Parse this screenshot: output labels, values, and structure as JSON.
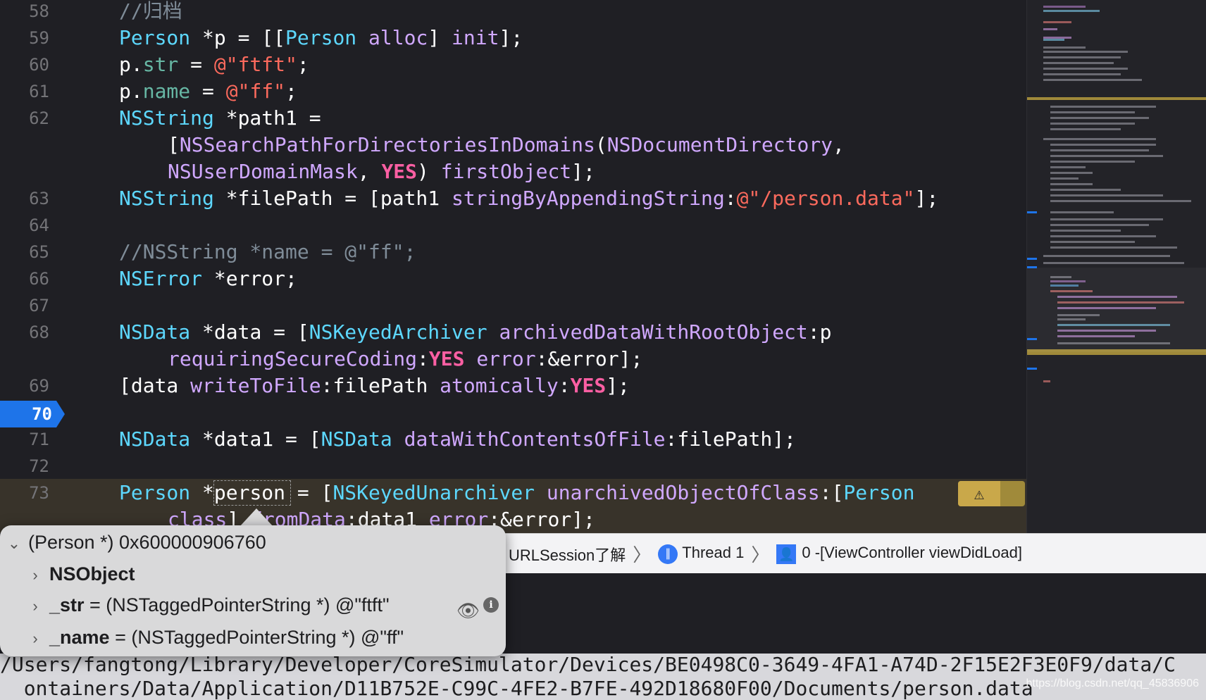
{
  "editor": {
    "lines": [
      {
        "num": "58",
        "tokens": [
          {
            "t": "//归档",
            "c": "cmt"
          }
        ]
      },
      {
        "num": "59",
        "tokens": [
          {
            "t": "Person",
            "c": "cls"
          },
          {
            "t": " *p = [[",
            "c": "plain"
          },
          {
            "t": "Person",
            "c": "cls"
          },
          {
            "t": " ",
            "c": "plain"
          },
          {
            "t": "alloc",
            "c": "meth"
          },
          {
            "t": "] ",
            "c": "plain"
          },
          {
            "t": "init",
            "c": "meth"
          },
          {
            "t": "];",
            "c": "plain"
          }
        ]
      },
      {
        "num": "60",
        "tokens": [
          {
            "t": "p.",
            "c": "plain"
          },
          {
            "t": "str",
            "c": "prop"
          },
          {
            "t": " = ",
            "c": "plain"
          },
          {
            "t": "@\"ftft\"",
            "c": "str"
          },
          {
            "t": ";",
            "c": "plain"
          }
        ]
      },
      {
        "num": "61",
        "tokens": [
          {
            "t": "p.",
            "c": "plain"
          },
          {
            "t": "name",
            "c": "prop"
          },
          {
            "t": " = ",
            "c": "plain"
          },
          {
            "t": "@\"ff\"",
            "c": "str"
          },
          {
            "t": ";",
            "c": "plain"
          }
        ]
      },
      {
        "num": "62",
        "tokens": [
          {
            "t": "NSString",
            "c": "cls"
          },
          {
            "t": " *path1 =",
            "c": "plain"
          }
        ]
      },
      {
        "num": "",
        "cont": true,
        "tokens": [
          {
            "t": "[",
            "c": "plain"
          },
          {
            "t": "NSSearchPathForDirectoriesInDomains",
            "c": "meth"
          },
          {
            "t": "(",
            "c": "plain"
          },
          {
            "t": "NSDocumentDirectory",
            "c": "meth"
          },
          {
            "t": ",",
            "c": "plain"
          }
        ]
      },
      {
        "num": "",
        "cont": true,
        "tokens": [
          {
            "t": "NSUserDomainMask",
            "c": "meth"
          },
          {
            "t": ", ",
            "c": "plain"
          },
          {
            "t": "YES",
            "c": "kw"
          },
          {
            "t": ") ",
            "c": "plain"
          },
          {
            "t": "firstObject",
            "c": "meth"
          },
          {
            "t": "];",
            "c": "plain"
          }
        ]
      },
      {
        "num": "63",
        "tokens": [
          {
            "t": "NSString",
            "c": "cls"
          },
          {
            "t": " *filePath = [path1 ",
            "c": "plain"
          },
          {
            "t": "stringByAppendingString",
            "c": "meth"
          },
          {
            "t": ":",
            "c": "plain"
          },
          {
            "t": "@\"/person.data\"",
            "c": "str"
          },
          {
            "t": "];",
            "c": "plain"
          }
        ]
      },
      {
        "num": "64",
        "tokens": []
      },
      {
        "num": "65",
        "tokens": [
          {
            "t": "//NSString *name = @\"ff\";",
            "c": "cmt"
          }
        ]
      },
      {
        "num": "66",
        "tokens": [
          {
            "t": "NSError",
            "c": "cls"
          },
          {
            "t": " *error;",
            "c": "plain"
          }
        ]
      },
      {
        "num": "67",
        "tokens": []
      },
      {
        "num": "68",
        "tokens": [
          {
            "t": "NSData",
            "c": "cls"
          },
          {
            "t": " *data = [",
            "c": "plain"
          },
          {
            "t": "NSKeyedArchiver",
            "c": "cls"
          },
          {
            "t": " ",
            "c": "plain"
          },
          {
            "t": "archivedDataWithRootObject",
            "c": "meth"
          },
          {
            "t": ":p",
            "c": "plain"
          }
        ]
      },
      {
        "num": "",
        "cont": true,
        "tokens": [
          {
            "t": "requiringSecureCoding",
            "c": "meth"
          },
          {
            "t": ":",
            "c": "plain"
          },
          {
            "t": "YES",
            "c": "kw"
          },
          {
            "t": " ",
            "c": "plain"
          },
          {
            "t": "error",
            "c": "meth"
          },
          {
            "t": ":&error];",
            "c": "plain"
          }
        ]
      },
      {
        "num": "69",
        "tokens": [
          {
            "t": "[data ",
            "c": "plain"
          },
          {
            "t": "writeToFile",
            "c": "meth"
          },
          {
            "t": ":filePath ",
            "c": "plain"
          },
          {
            "t": "atomically",
            "c": "meth"
          },
          {
            "t": ":",
            "c": "plain"
          },
          {
            "t": "YES",
            "c": "kw"
          },
          {
            "t": "];",
            "c": "plain"
          }
        ]
      },
      {
        "num": "70",
        "current": true,
        "tokens": []
      },
      {
        "num": "71",
        "tokens": [
          {
            "t": "NSData",
            "c": "cls"
          },
          {
            "t": " *data1 = [",
            "c": "plain"
          },
          {
            "t": "NSData",
            "c": "cls"
          },
          {
            "t": " ",
            "c": "plain"
          },
          {
            "t": "dataWithContentsOfFile",
            "c": "meth"
          },
          {
            "t": ":filePath];",
            "c": "plain"
          }
        ]
      },
      {
        "num": "72",
        "tokens": []
      },
      {
        "num": "73",
        "tokens": [
          {
            "t": "Person",
            "c": "cls"
          },
          {
            "t": " *person = [",
            "c": "plain"
          },
          {
            "t": "NSKeyedUnarchiver",
            "c": "cls"
          },
          {
            "t": " ",
            "c": "plain"
          },
          {
            "t": "unarchivedObjectOfClass",
            "c": "meth"
          },
          {
            "t": ":[",
            "c": "plain"
          },
          {
            "t": "Person",
            "c": "cls"
          }
        ]
      },
      {
        "num": "",
        "cont": true,
        "tokens": [
          {
            "t": "class",
            "c": "meth"
          },
          {
            "t": "] ",
            "c": "plain"
          },
          {
            "t": "fromData",
            "c": "meth"
          },
          {
            "t": ":data1 ",
            "c": "plain"
          },
          {
            "t": "error",
            "c": "meth"
          },
          {
            "t": ":&error];",
            "c": "plain"
          }
        ]
      }
    ],
    "current_line_label": "70",
    "warning_icon": "warning-triangle-icon"
  },
  "debug_bar": {
    "crumb_partial": "URLSession了解",
    "thread_label": "Thread 1",
    "frame_label": "0 -[ViewController viewDidLoad]"
  },
  "popover": {
    "header": "(Person *) 0x600000906760",
    "rows": [
      {
        "name": "NSObject",
        "value": ""
      },
      {
        "name": "_str",
        "value": " = (NSTaggedPointerString *) @\"ftft\""
      },
      {
        "name": "_name",
        "value": " = (NSTaggedPointerString *) @\"ff\""
      }
    ]
  },
  "console": {
    "line1": "/Users/fangtong/Library/Developer/CoreSimulator/Devices/BE0498C0-3649-4FA1-A74D-2F15E2F3E0F9/data/C",
    "line2": "  ontainers/Data/Application/D11B752E-C99C-4FE2-B7FE-492D18680F00/Documents/person.data"
  },
  "watermark": "https://blog.csdn.net/qq_45836906",
  "colors": {
    "editor_bg": "#1f1f24",
    "keyword": "#fc5fa3",
    "class": "#5dd8ff",
    "method": "#d0a8ff",
    "property": "#67b7a4",
    "string": "#fc6a5d",
    "comment": "#7f8c98",
    "current_line": "#1e74e9",
    "warning": "#c9a84a"
  }
}
